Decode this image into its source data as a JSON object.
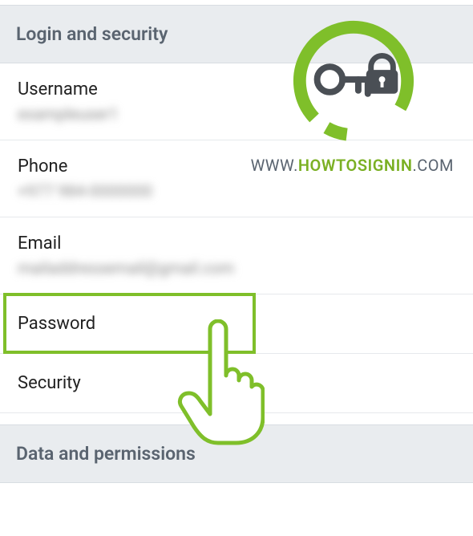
{
  "sections": {
    "login_security": "Login and security",
    "data_permissions": "Data and permissions"
  },
  "rows": {
    "username": {
      "label": "Username",
      "value": "exampleuser1"
    },
    "phone": {
      "label": "Phone",
      "value": "+977 984-0000000"
    },
    "email": {
      "label": "Email",
      "value": "mailaddressemail@gmail.com"
    },
    "password": {
      "label": "Password"
    },
    "security": {
      "label": "Security"
    }
  },
  "watermark": {
    "prefix": "WWW.",
    "main": "HOWTOSIGNIN",
    "suffix": ".COM"
  },
  "colors": {
    "accent": "#7fbf2a",
    "header_bg": "#e9ecef",
    "text_primary": "#222",
    "text_secondary": "#5a6470",
    "divider": "#e6e9ec"
  }
}
